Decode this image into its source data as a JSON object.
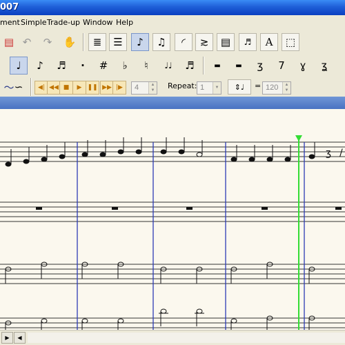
{
  "window": {
    "title_fragment": "007"
  },
  "menu": [
    {
      "label": "ment"
    },
    {
      "label": "Simple"
    },
    {
      "label": "Trade-up"
    },
    {
      "label": "Window"
    },
    {
      "label": "Help"
    }
  ],
  "toolbar1": {
    "icons": [
      "print-icon",
      "undo-icon",
      "redo-icon",
      "hand-icon",
      "staff-icon",
      "page-icon",
      "note-tool-icon",
      "beamed-notes-icon",
      "slur-icon",
      "expression-icon",
      "layout-icon",
      "guitar-icon",
      "text-icon",
      "selection-icon"
    ],
    "glyphs": [
      "",
      "↶",
      "↷",
      "✋",
      "≣",
      "☰",
      "♪",
      "♫",
      "◜",
      "≳",
      "▤",
      "🎸",
      "A",
      "⬚"
    ]
  },
  "toolbar2": {
    "glyphs": [
      "♩",
      "♪",
      "𝅘𝅥𝅯",
      "·",
      "#",
      "♭",
      "♮",
      "♩♩",
      "♬",
      "▬",
      "▬",
      "𝄽",
      "𝄾",
      "𝄿",
      "𝅀"
    ]
  },
  "toolbar3": {
    "playback": [
      "◀|",
      "◀◀",
      "■",
      "▶",
      "❚❚",
      "▶▶",
      "|▶"
    ],
    "tempo_value": "4",
    "repeat_label": "Repeat:",
    "repeat_value": "1",
    "equals": "=",
    "bpm_value": "120"
  },
  "score": {
    "playback_position_measure": 5
  },
  "colors": {
    "titlebar": "#1f5fd8",
    "barline": "#2b3bb5",
    "cursor": "#33dd33",
    "score_bg": "#fbf8ee"
  }
}
